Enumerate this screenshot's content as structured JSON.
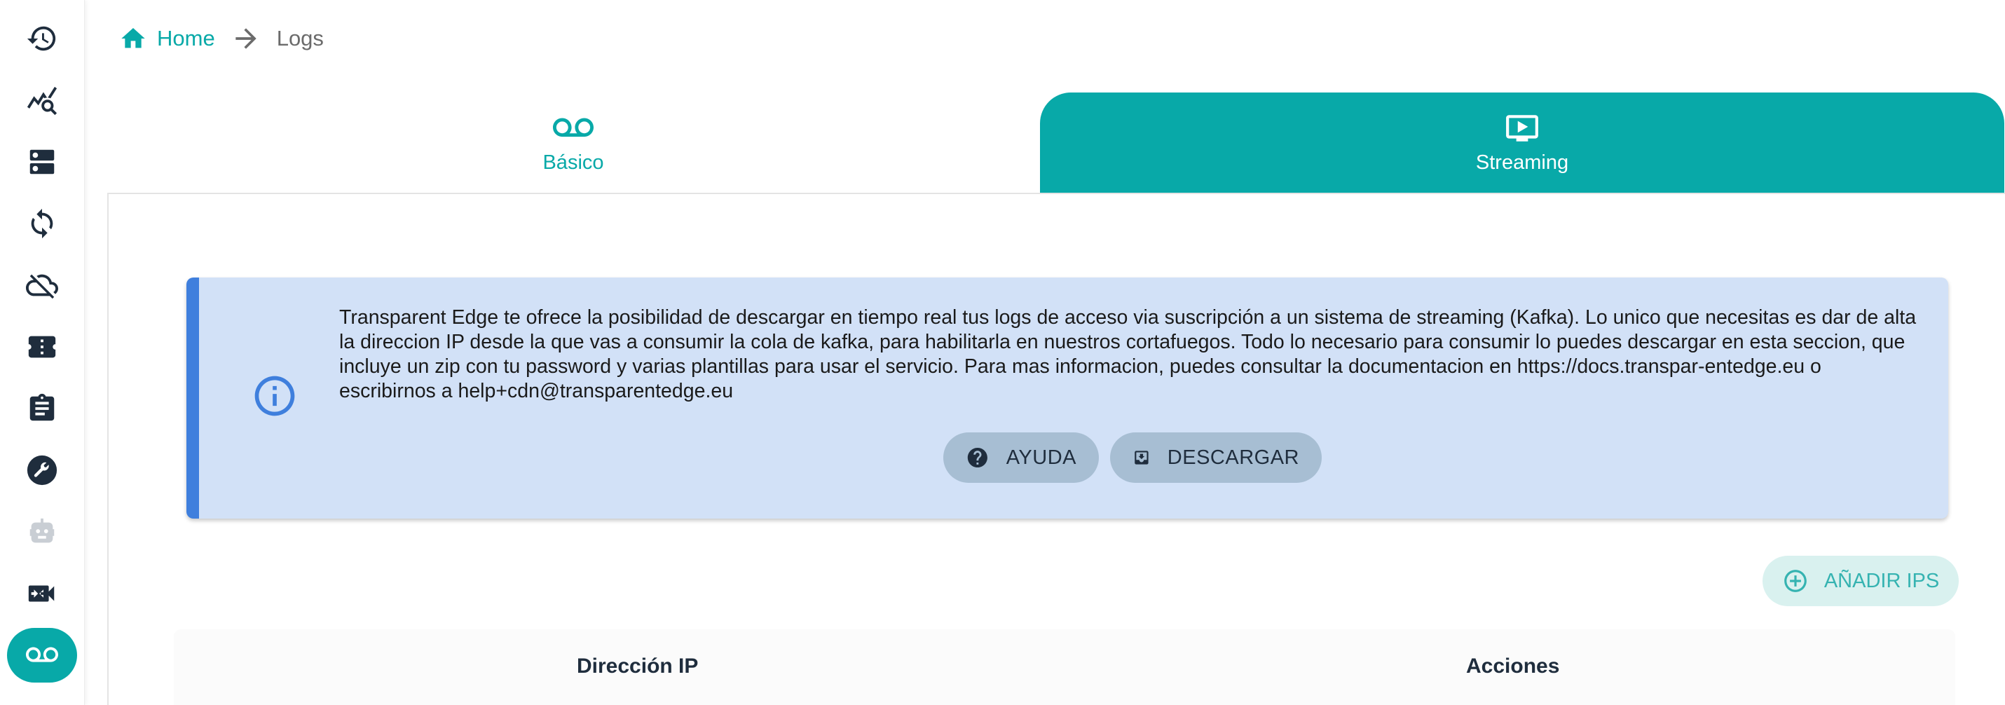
{
  "sidebar": {
    "items": [
      {
        "icon": "history-icon",
        "name": "sidebar-item-history",
        "active": false
      },
      {
        "icon": "query-stats-icon",
        "name": "sidebar-item-analytics",
        "active": false
      },
      {
        "icon": "dns-icon",
        "name": "sidebar-item-servers",
        "active": false
      },
      {
        "icon": "sync-icon",
        "name": "sidebar-item-sync",
        "active": false
      },
      {
        "icon": "cloud-off-icon",
        "name": "sidebar-item-cloud-off",
        "active": false
      },
      {
        "icon": "ticket-icon",
        "name": "sidebar-item-tickets",
        "active": false
      },
      {
        "icon": "clipboard-icon",
        "name": "sidebar-item-reports",
        "active": false
      },
      {
        "icon": "wrench-icon",
        "name": "sidebar-item-tools",
        "active": false
      },
      {
        "icon": "robot-icon",
        "name": "sidebar-item-bot",
        "active": false
      },
      {
        "icon": "video-settings-icon",
        "name": "sidebar-item-video",
        "active": false
      },
      {
        "icon": "voicemail-icon",
        "name": "sidebar-item-logs",
        "active": true
      }
    ],
    "accent": "#08a9a8",
    "icon_color": "#1f2d3d"
  },
  "breadcrumb": {
    "home": "Home",
    "current": "Logs"
  },
  "tabs": [
    {
      "label": "Básico",
      "icon": "voicemail-icon",
      "active": false
    },
    {
      "label": "Streaming",
      "icon": "play-screen-icon",
      "active": true
    }
  ],
  "alert": {
    "message": "Transparent Edge te ofrece la posibilidad de descargar en tiempo real tus logs de acceso via suscripción a un sistema de streaming (Kafka). Lo unico que necesitas es dar de alta la direccion IP desde la que vas a consumir la cola de kafka, para habilitarla en nuestros cortafuegos. Todo lo necesario para consumir lo puedes descargar en esta seccion, que incluye un zip con tu password y varias plantillas para usar el servicio. Para mas informacion, puedes consultar la documentacion en https://docs.transpar-entedge.eu o escribirnos a help+cdn@transparentedge.eu",
    "help_label": "AYUDA",
    "download_label": "DESCARGAR",
    "icon": "info-icon",
    "bg_color": "#d2e1f7",
    "bar_color": "#3f7fdd"
  },
  "actions": {
    "add_ips_label": "AÑADIR IPS"
  },
  "table": {
    "columns": [
      "Dirección IP",
      "Acciones"
    ]
  }
}
